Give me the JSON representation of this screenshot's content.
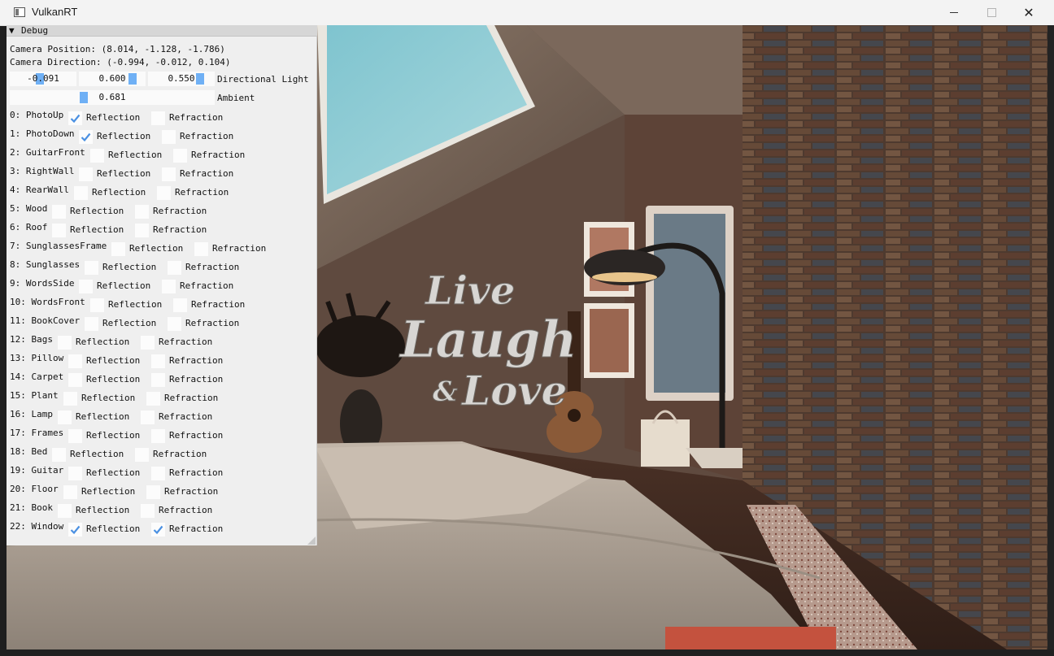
{
  "window": {
    "title": "VulkanRT"
  },
  "debug": {
    "header": "Debug",
    "camera_position": "Camera Position: (8.014, -1.128, -1.786)",
    "camera_direction": "Camera Direction: (-0.994, -0.012, 0.104)",
    "directional_light": {
      "label": "Directional Light",
      "x": "-0.091",
      "y": "0.600",
      "z": "0.550",
      "x_level": -0.091,
      "y_level": 0.6,
      "z_level": 0.55
    },
    "ambient": {
      "label": "Ambient",
      "value": "0.681",
      "level": 0.681
    },
    "reflection_label": "Reflection",
    "refraction_label": "Refraction",
    "objects": [
      {
        "label": "0: PhotoUp",
        "reflection": true,
        "refraction": false
      },
      {
        "label": "1: PhotoDown",
        "reflection": true,
        "refraction": false
      },
      {
        "label": "2: GuitarFront",
        "reflection": false,
        "refraction": false
      },
      {
        "label": "3: RightWall",
        "reflection": false,
        "refraction": false
      },
      {
        "label": "4: RearWall",
        "reflection": false,
        "refraction": false
      },
      {
        "label": "5: Wood",
        "reflection": false,
        "refraction": false
      },
      {
        "label": "6: Roof",
        "reflection": false,
        "refraction": false
      },
      {
        "label": "7: SunglassesFrame",
        "reflection": false,
        "refraction": false
      },
      {
        "label": "8: Sunglasses",
        "reflection": false,
        "refraction": false
      },
      {
        "label": "9: WordsSide",
        "reflection": false,
        "refraction": false
      },
      {
        "label": "10: WordsFront",
        "reflection": false,
        "refraction": false
      },
      {
        "label": "11: BookCover",
        "reflection": false,
        "refraction": false
      },
      {
        "label": "12: Bags",
        "reflection": false,
        "refraction": false
      },
      {
        "label": "13: Pillow",
        "reflection": false,
        "refraction": false
      },
      {
        "label": "14: Carpet",
        "reflection": false,
        "refraction": false
      },
      {
        "label": "15: Plant",
        "reflection": false,
        "refraction": false
      },
      {
        "label": "16: Lamp",
        "reflection": false,
        "refraction": false
      },
      {
        "label": "17: Frames",
        "reflection": false,
        "refraction": false
      },
      {
        "label": "18: Bed",
        "reflection": false,
        "refraction": false
      },
      {
        "label": "19: Guitar",
        "reflection": false,
        "refraction": false
      },
      {
        "label": "20: Floor",
        "reflection": false,
        "refraction": false
      },
      {
        "label": "21: Book",
        "reflection": false,
        "refraction": false
      },
      {
        "label": "22: Window",
        "reflection": true,
        "refraction": true
      }
    ]
  },
  "scene": {
    "sign_words": [
      "Live",
      "Laugh",
      "Love"
    ],
    "sign_ampersand": "&"
  },
  "colors": {
    "accent": "#4a90e2",
    "slider_grab": "#6fb0f5",
    "panel_bg": "#efefef"
  }
}
